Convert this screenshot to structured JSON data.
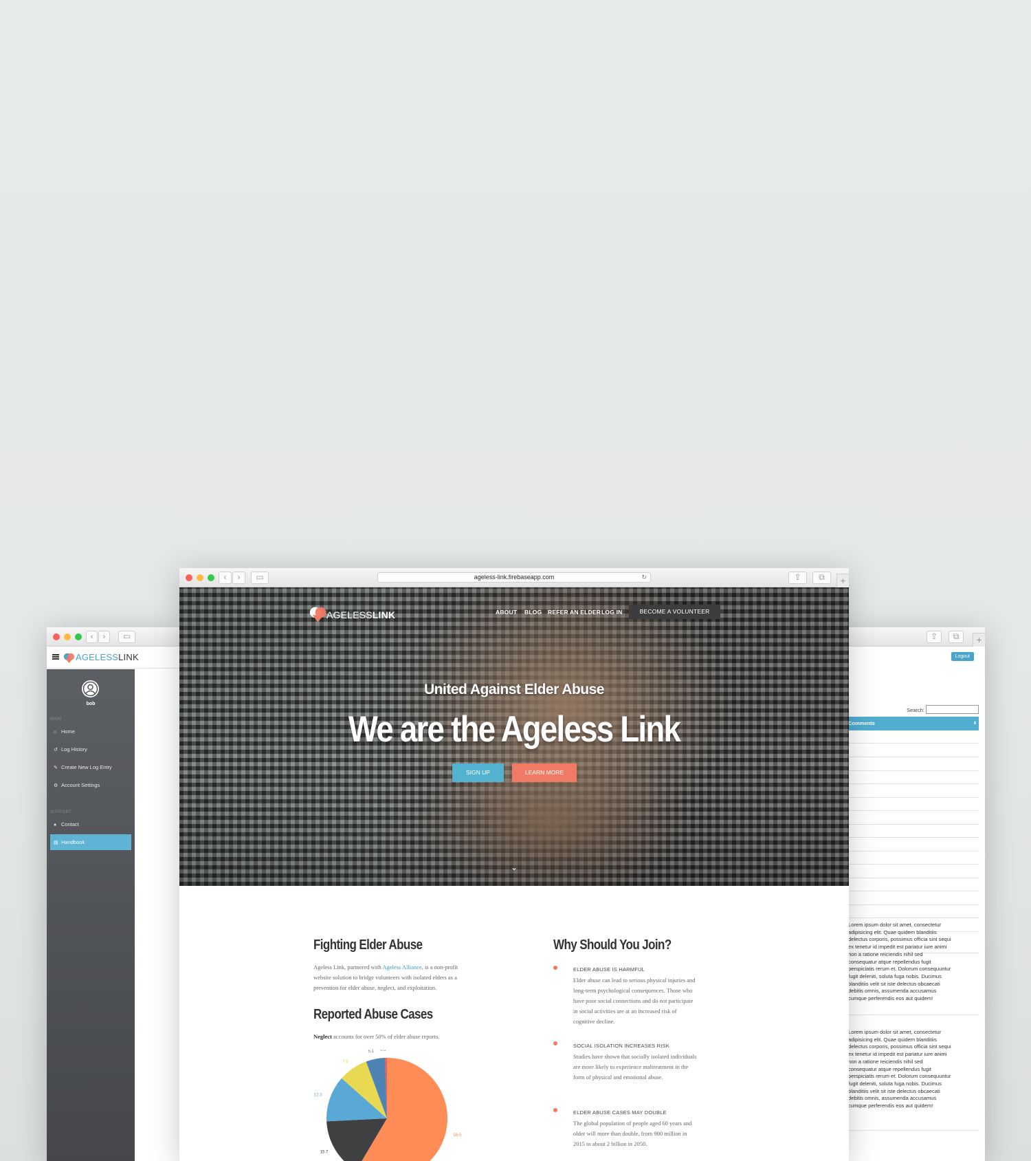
{
  "left_window": {
    "brand": {
      "part1": "AGELESS",
      "part2": "LINK"
    },
    "user": "bob",
    "sections": [
      {
        "heading": "MAIN",
        "items": [
          {
            "label": "Home",
            "icon": "home-icon"
          },
          {
            "label": "Log History",
            "icon": "history-icon"
          },
          {
            "label": "Create New Log Entry",
            "icon": "pencil-icon"
          },
          {
            "label": "Account Settings",
            "icon": "cogs-icon"
          }
        ]
      },
      {
        "heading": "SUPPORT",
        "items": [
          {
            "label": "Contact",
            "icon": "user-icon"
          },
          {
            "label": "Handbook",
            "icon": "book-icon",
            "active": true
          }
        ]
      }
    ]
  },
  "right_window": {
    "logout": "Logout",
    "search_label": "Search:",
    "column_header": "Comments",
    "comment_text": "Lorem ipsum dolor sit amet, consectetur adipisicing elit. Quae quidem blanditiis delectus corporis, possimus officia sint sequi ex tenetur id impedit est pariatur iure animi non a ratione reiciendis nihil sed consequatur atque repellendus fugit perspiciatis rerum et. Dolorum consequuntur fugit deleniti, soluta fuga nobis. Ducimus blanditiis velit sit iste delectus obcaecati debitis omnis, assumenda accusamus cumque perferendis eos aut quidem!",
    "comments": [
      "Lorem ipsum dolor sit amet, consectetur adipisicing elit. Quae quidem blanditiis delectus corporis, possimus officia sint sequi ex tenetur id impedit est pariatur iure animi non a ratione reiciendis nihil sed consequatur atque repellendus fugit perspiciatis rerum et. Dolorum consequuntur fugit deleniti, soluta fuga nobis. Ducimus blanditiis velit sit iste delectus obcaecati debitis omnis, assumenda accusamus cumque perferendis eos aut quidem!",
      "Lorem ipsum dolor sit amet, consectetur adipisicing elit. Quae quidem blanditiis delectus corporis, possimus officia sint sequi ex tenetur id impedit est pariatur iure animi non a ratione reiciendis nihil sed consequatur atque repellendus fugit perspiciatis rerum et. Dolorum consequuntur fugit deleniti, soluta fuga nobis. Ducimus blanditiis velit sit iste delectus obcaecati debitis omnis, assumenda accusamus cumque perferendis eos aut quidem!"
    ]
  },
  "center_window": {
    "url": "ageless-link.firebaseapp.com",
    "brand": {
      "part1": "AGELESS",
      "part2": "LINK"
    },
    "nav": [
      "ABOUT",
      "BLOG",
      "REFER AN ELDER",
      "LOG IN"
    ],
    "cta": "BECOME A VOLUNTEER",
    "hero_subtitle": "United Against Elder Abuse",
    "hero_title": "We are the Ageless Link",
    "btn_signup": "SIGN UP",
    "btn_learn": "LEARN MORE",
    "fighting": {
      "heading": "Fighting Elder Abuse",
      "text_before": "Ageless Link, partnered with ",
      "link": "Ageless Alliance",
      "text_after": ", is a non-profit website solution to bridge volunteers with isolated elders as a prevention for elder abuse, neglect, and exploitation."
    },
    "reported": {
      "heading": "Reported Abuse Cases",
      "bold": "Neglect",
      "text": " accounts for over 50% of elder abuse reports."
    },
    "why": {
      "heading": "Why Should You Join?",
      "points": [
        {
          "title": "ELDER ABUSE IS HARMFUL",
          "body": "Elder abuse can lead to serious physical injuries and long-term psychological consequences. Those who have poor social connections and do not participate in social activities are at an increased risk of cognitive decline."
        },
        {
          "title": "SOCIAL ISOLATION INCREASES RISK",
          "body": "Studies have shown that socially isolated individuals are more likely to experience maltreatment in the form of physical and emotional abuse."
        },
        {
          "title": "ELDER ABUSE CASES MAY DOUBLE",
          "body": "The global population of people aged 60 years and older will more than double, from 900 million in 2015 to about 2 billion in 2050."
        }
      ]
    }
  },
  "chart_data": {
    "type": "pie",
    "slices": [
      {
        "label": "58.5",
        "value": 58.5,
        "color": "#fe8c57"
      },
      {
        "label": "15.7",
        "value": 15.7,
        "color": "#3f4042"
      },
      {
        "label": "12.3",
        "value": 12.3,
        "color": "#5aa8d6"
      },
      {
        "label": "7.9",
        "value": 7.9,
        "color": "#e8d852"
      },
      {
        "label": "5.1",
        "value": 5.1,
        "color": "#4f83b4"
      },
      {
        "label": "0.5",
        "value": 0.5,
        "color": "#ef5b57"
      }
    ]
  }
}
